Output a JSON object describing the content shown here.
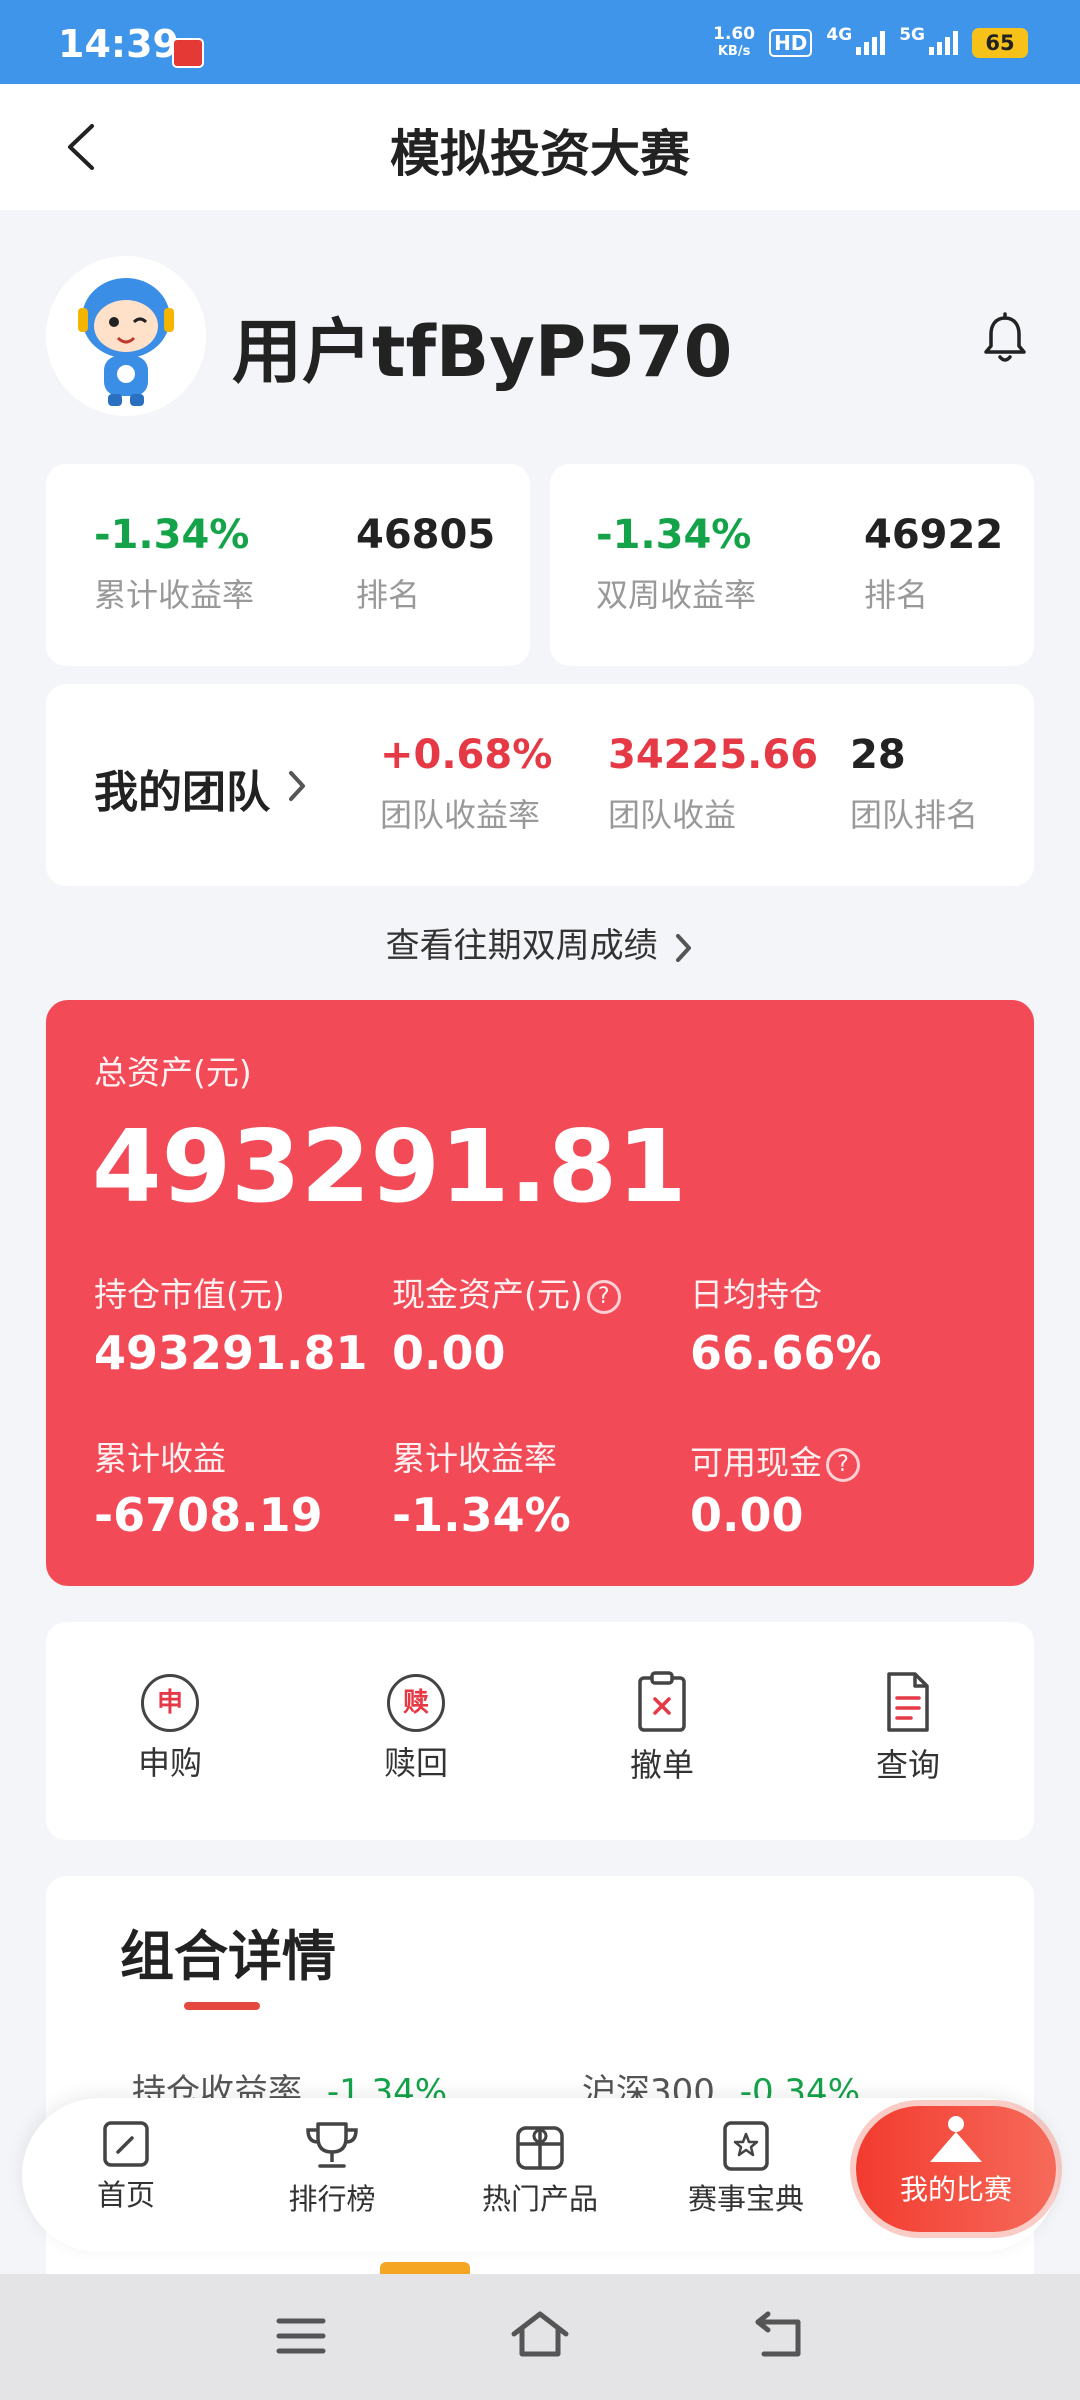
{
  "status_bar": {
    "time": "14:39",
    "speed": "1.60",
    "speed_unit": "KB/s",
    "hd": "HD",
    "net_4g": "4G",
    "net_5g": "5G",
    "battery": "65"
  },
  "header": {
    "title": "模拟投资大赛"
  },
  "profile": {
    "username": "用户tfByP570"
  },
  "stats": [
    {
      "value": "-1.34%",
      "label": "累计收益率",
      "rank": "46805",
      "rank_label": "排名"
    },
    {
      "value": "-1.34%",
      "label": "双周收益率",
      "rank": "46922",
      "rank_label": "排名"
    }
  ],
  "team": {
    "title": "我的团队",
    "return_rate": "+0.68%",
    "return_rate_label": "团队收益率",
    "profit": "34225.66",
    "profit_label": "团队收益",
    "rank": "28",
    "rank_label": "团队排名"
  },
  "history_link": "查看往期双周成绩",
  "assets": {
    "total_label": "总资产(元)",
    "total_value": "493291.81",
    "items": [
      {
        "label": "持仓市值(元)",
        "value": "493291.81"
      },
      {
        "label": "现金资产(元)",
        "value": "0.00"
      },
      {
        "label": "日均持仓",
        "value": "66.66%"
      },
      {
        "label": "累计收益",
        "value": "-6708.19"
      },
      {
        "label": "累计收益率",
        "value": "-1.34%"
      },
      {
        "label": "可用现金",
        "value": "0.00"
      }
    ],
    "help_mark": "?"
  },
  "actions": [
    {
      "icon_text": "申",
      "label": "申购"
    },
    {
      "icon_text": "赎",
      "label": "赎回"
    },
    {
      "label": "撤单"
    },
    {
      "label": "查询"
    }
  ],
  "details": {
    "title": "组合详情",
    "row_left_label": "持仓收益率",
    "row_left_value": "-1.34%",
    "row_right_label": "沪深300",
    "row_right_value": "-0.34%"
  },
  "bottom_nav": [
    {
      "label": "首页"
    },
    {
      "label": "排行榜"
    },
    {
      "label": "热门产品"
    },
    {
      "label": "赛事宝典"
    },
    {
      "label": "我的比赛"
    }
  ],
  "colors": {
    "status_bar": "#3f95e9",
    "card_red": "#f24a57",
    "gain_green": "#15a34a",
    "accent_red": "#e53a45"
  }
}
